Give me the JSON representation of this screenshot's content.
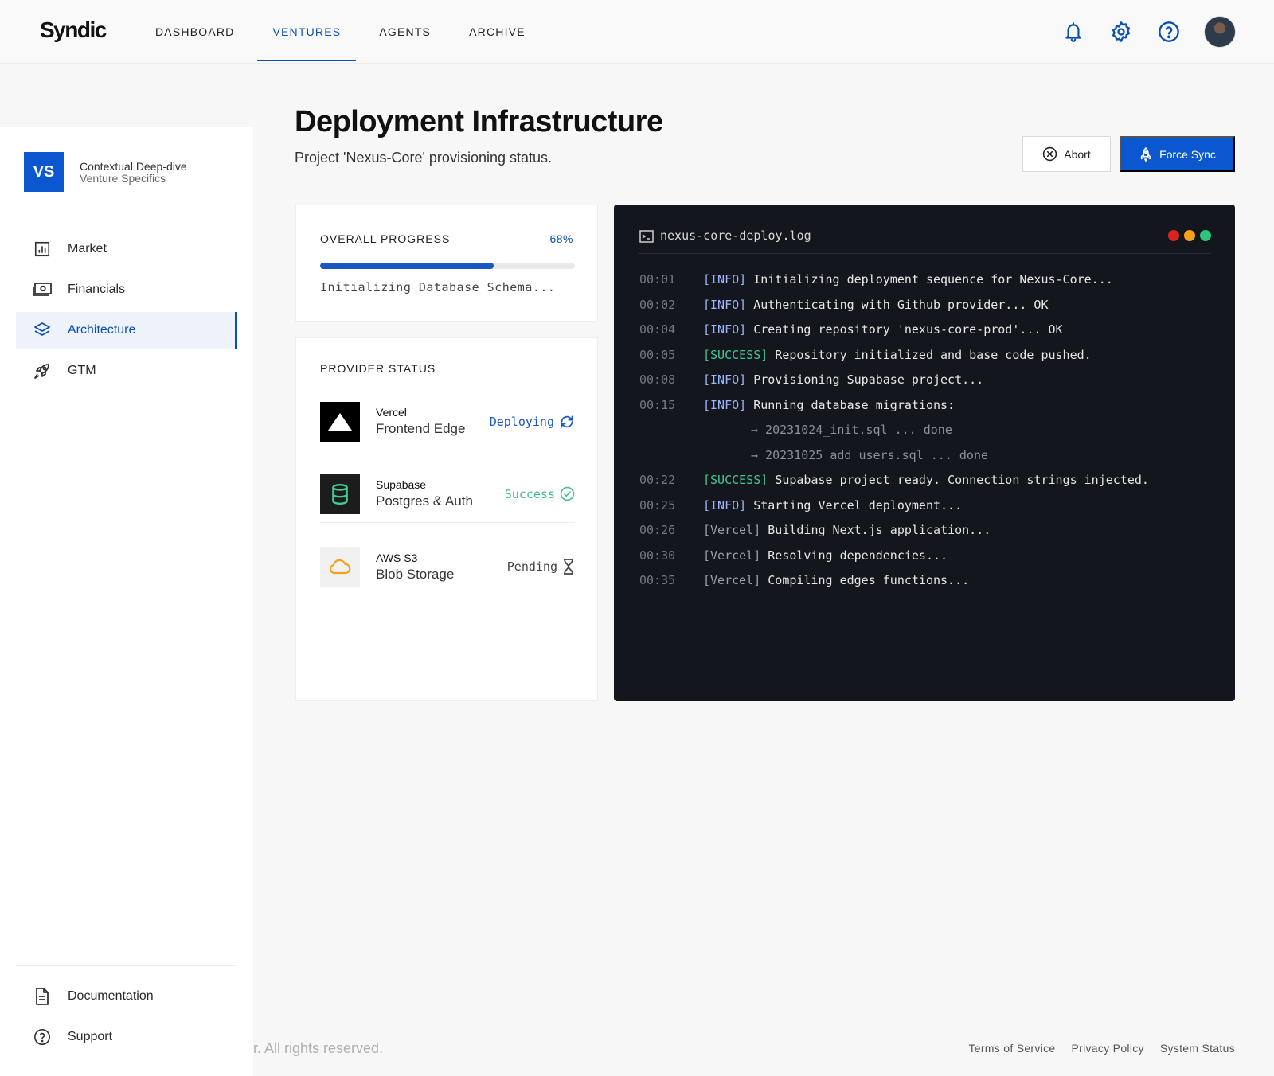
{
  "header": {
    "logo": "Syndic",
    "nav": [
      {
        "label": "DASHBOARD"
      },
      {
        "label": "VENTURES"
      },
      {
        "label": "AGENTS"
      },
      {
        "label": "ARCHIVE"
      }
    ],
    "active_nav": "VENTURES",
    "icons": [
      "bell-icon",
      "gear-icon",
      "help-icon"
    ]
  },
  "sidebar": {
    "badge": "VS",
    "context_title": "Contextual Deep-dive",
    "context_subtitle": "Venture Specifics",
    "items": [
      {
        "label": "Market",
        "icon": "bar-chart-icon"
      },
      {
        "label": "Financials",
        "icon": "cash-icon"
      },
      {
        "label": "Architecture",
        "icon": "layers-icon"
      },
      {
        "label": "GTM",
        "icon": "rocket-icon"
      }
    ],
    "active_item": "Architecture",
    "bottom": [
      {
        "label": "Documentation",
        "icon": "document-icon"
      },
      {
        "label": "Support",
        "icon": "help-icon"
      }
    ]
  },
  "page": {
    "title": "Deployment Infrastructure",
    "subtitle": "Project 'Nexus-Core' provisioning status.",
    "abort_label": "Abort",
    "sync_label": "Force Sync"
  },
  "progress": {
    "label": "OVERALL PROGRESS",
    "percent_text": "68%",
    "fraction": 0.68,
    "status": "Initializing Database Schema..."
  },
  "providers": {
    "label": "PROVIDER STATUS",
    "items": [
      {
        "name": "Vercel",
        "desc": "Frontend Edge",
        "state": "Deploying",
        "color": "#1a57c0"
      },
      {
        "name": "Supabase",
        "desc": "Postgres & Auth",
        "state": "Success",
        "color": "#3fbf86"
      },
      {
        "name": "AWS S3",
        "desc": "Blob Storage",
        "state": "Pending",
        "color": "#444444"
      }
    ]
  },
  "terminal": {
    "filename": "nexus-core-deploy.log",
    "dot_colors": [
      "#d9231f",
      "#f5a11a",
      "#2cc57a"
    ],
    "lines": [
      {
        "ts": "00:01",
        "tag": "[INFO]",
        "kind": "info",
        "msg": "Initializing deployment sequence for Nexus-Core..."
      },
      {
        "ts": "00:02",
        "tag": "[INFO]",
        "kind": "info",
        "msg": "Authenticating with Github provider... OK"
      },
      {
        "ts": "00:04",
        "tag": "[INFO]",
        "kind": "info",
        "msg": "Creating repository 'nexus-core-prod'... OK"
      },
      {
        "ts": "00:05",
        "tag": "[SUCCESS]",
        "kind": "success",
        "msg": "Repository initialized and base code pushed."
      },
      {
        "ts": "00:08",
        "tag": "[INFO]",
        "kind": "info",
        "msg": "Provisioning Supabase project..."
      },
      {
        "ts": "00:15",
        "tag": "[INFO]",
        "kind": "info",
        "msg": "Running database migrations:"
      },
      {
        "ts": "",
        "tag": "",
        "kind": "sub",
        "msg": "→ 20231024_init.sql ... done"
      },
      {
        "ts": "",
        "tag": "",
        "kind": "sub",
        "msg": "→ 20231025_add_users.sql ... done"
      },
      {
        "ts": "00:22",
        "tag": "[SUCCESS]",
        "kind": "success",
        "msg": "Supabase project ready. Connection strings injected."
      },
      {
        "ts": "00:25",
        "tag": "[INFO]",
        "kind": "info",
        "msg": "Starting Vercel deployment..."
      },
      {
        "ts": "00:26",
        "tag": "[Vercel]",
        "kind": "vercel",
        "msg": "Building Next.js application..."
      },
      {
        "ts": "00:30",
        "tag": "[Vercel]",
        "kind": "vercel",
        "msg": "Resolving dependencies..."
      },
      {
        "ts": "00:35",
        "tag": "[Vercel]",
        "kind": "vercel",
        "msg": "Compiling edges functions..."
      }
    ],
    "cursor": "_"
  },
  "footer": {
    "copyright": "r. All rights reserved.",
    "links": [
      "Terms of Service",
      "Privacy Policy",
      "System Status"
    ]
  }
}
